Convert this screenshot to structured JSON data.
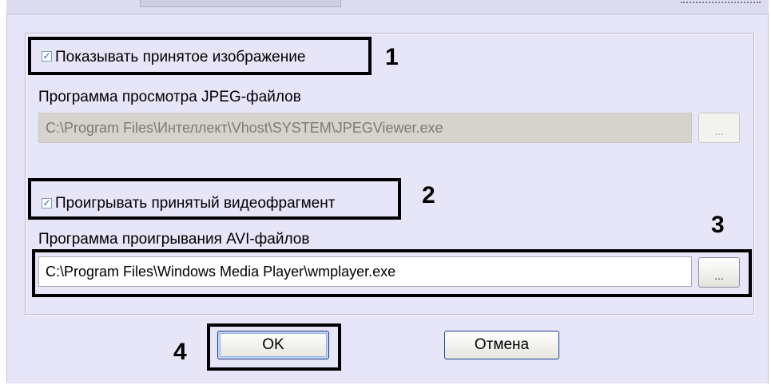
{
  "window": {
    "show_image_checkbox": {
      "label": "Показывать принятое изображение",
      "checked": true
    },
    "jpeg_viewer": {
      "label": "Программа просмотра JPEG-файлов",
      "value": "C:\\Program Files\\Интеллект\\Vhost\\SYSTEM\\JPEGViewer.exe",
      "browse_label": "...",
      "enabled": false
    },
    "play_video_checkbox": {
      "label": "Проигрывать принятый видеофрагмент",
      "checked": true
    },
    "avi_player": {
      "label": "Программа проигрывания AVI-файлов",
      "value": "C:\\Program Files\\Windows Media Player\\wmplayer.exe",
      "browse_label": "...",
      "enabled": true
    },
    "buttons": {
      "ok": "OK",
      "cancel": "Отмена"
    }
  },
  "annotations": [
    "1",
    "2",
    "3",
    "4"
  ],
  "colors": {
    "dialog_bg": "#e7e5f8",
    "highlight": "#000000",
    "checkmark": "#3c59a8"
  }
}
